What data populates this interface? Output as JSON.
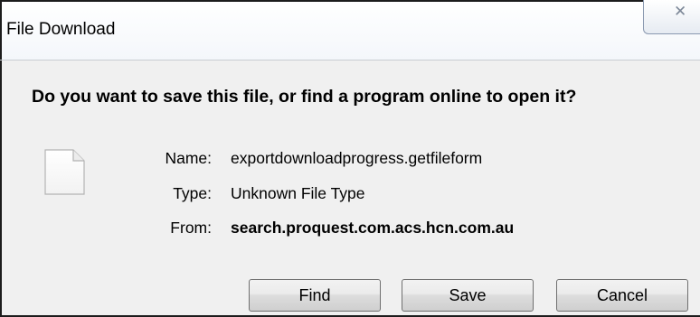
{
  "window": {
    "title": "File Download",
    "close_icon": "close-icon",
    "close_glyph": "✕"
  },
  "prompt": {
    "question": "Do you want to save this file, or find a program online to open it?"
  },
  "file": {
    "icon": "document-icon",
    "name_label": "Name:",
    "name_value": "exportdownloadprogress.getfileform",
    "type_label": "Type:",
    "type_value": "Unknown File Type",
    "from_label": "From:",
    "from_value": "search.proquest.com.acs.hcn.com.au"
  },
  "buttons": {
    "find_label": "Find",
    "save_label": "Save",
    "cancel_label": "Cancel"
  }
}
